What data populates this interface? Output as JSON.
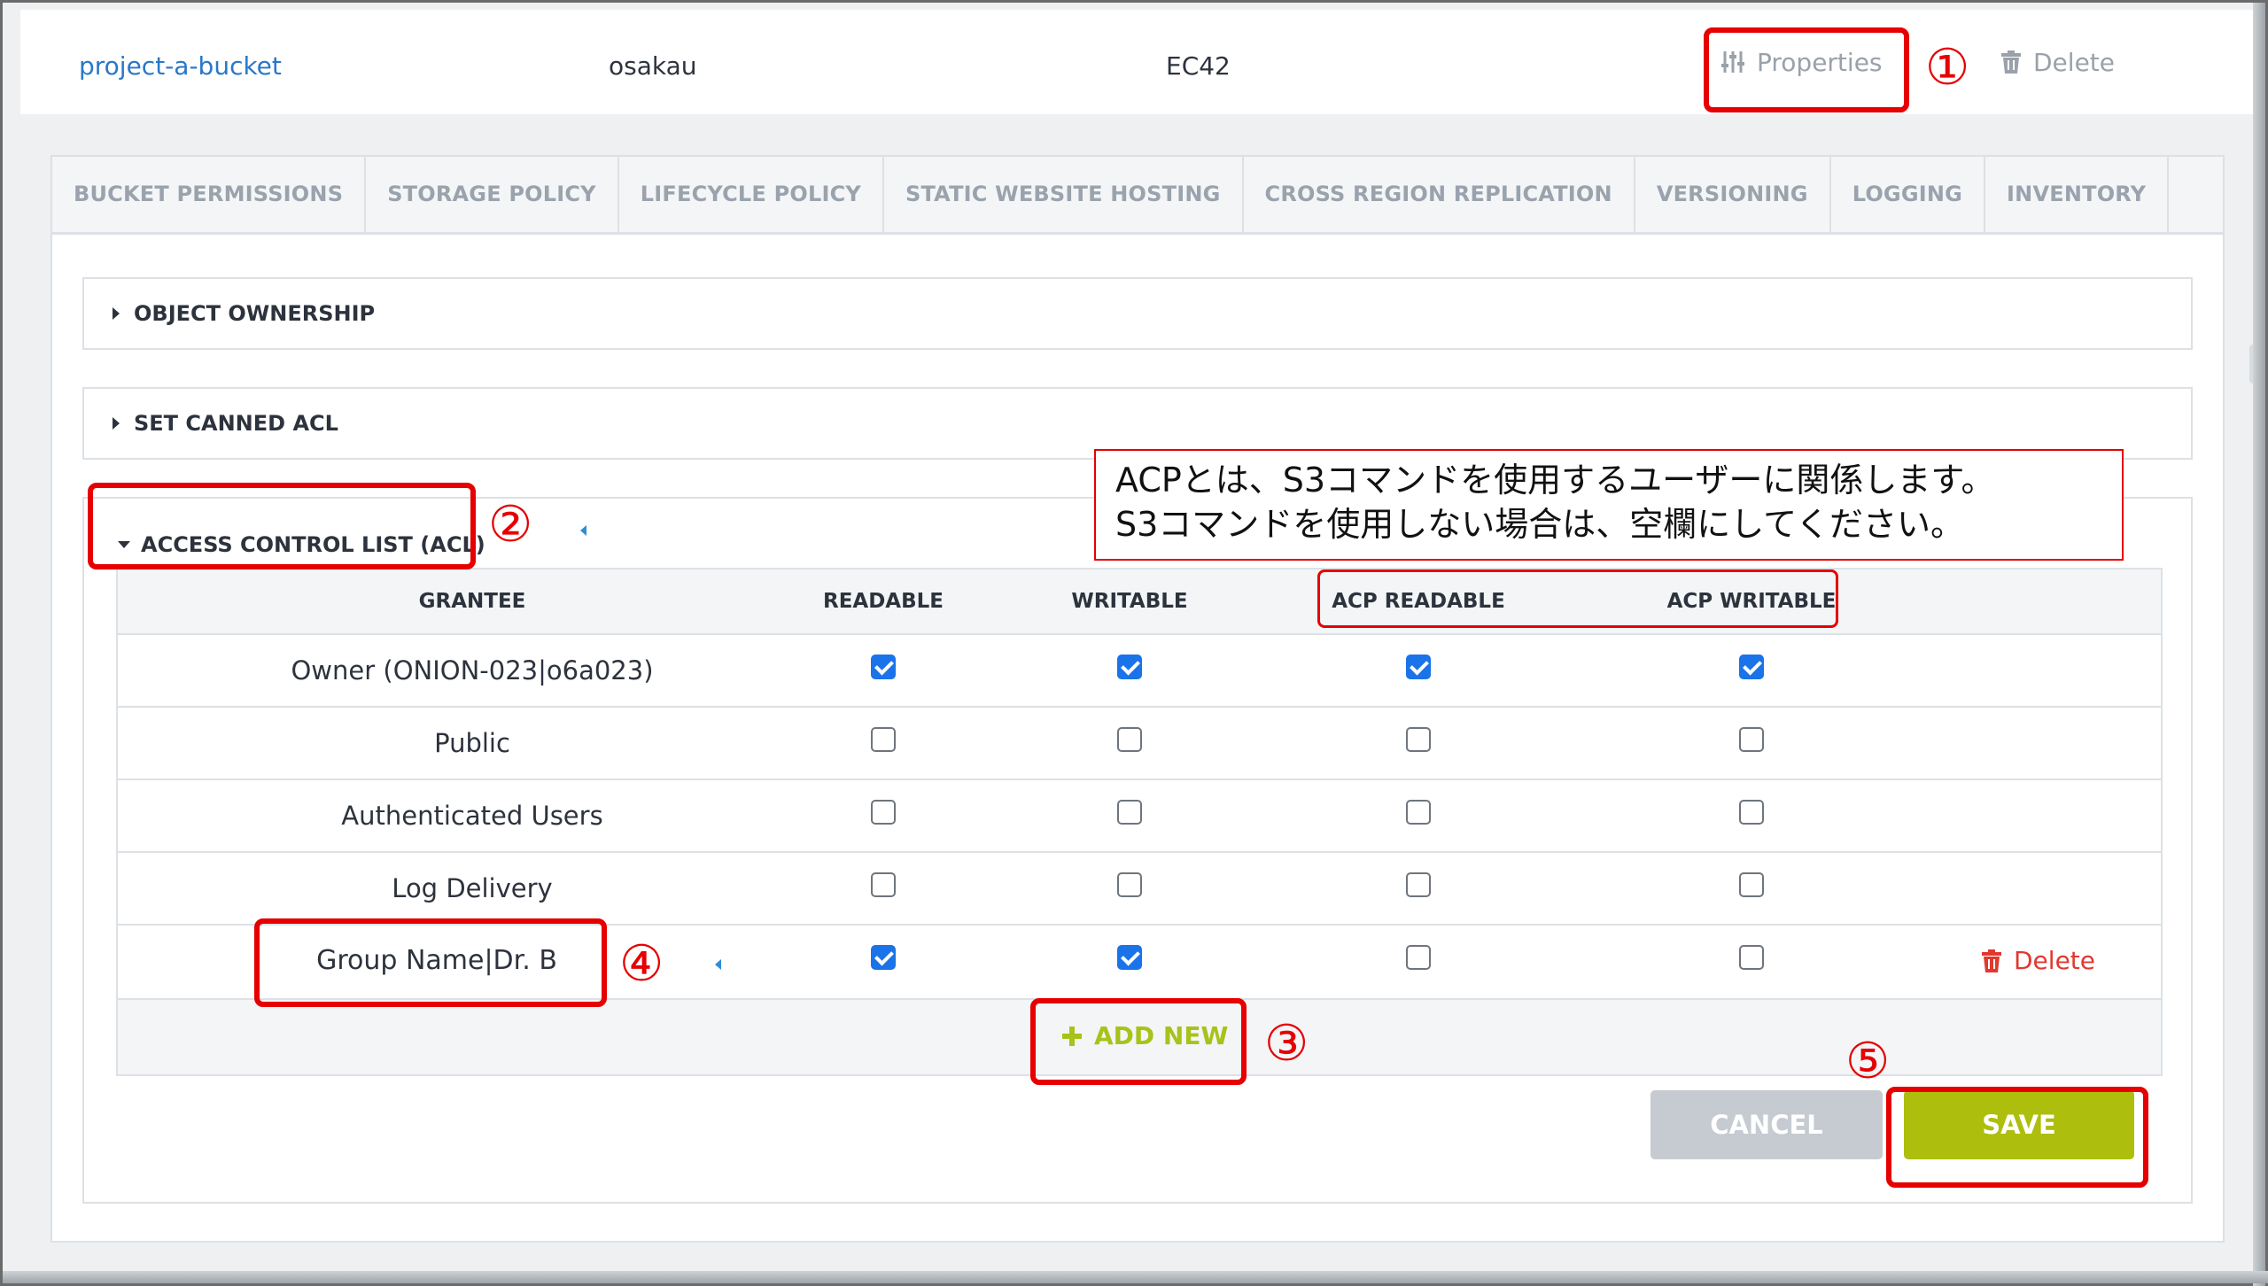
{
  "header": {
    "bucket_name": "project-a-bucket",
    "region": "osakau",
    "storage_policy": "EC42",
    "properties_label": "Properties",
    "delete_label": "Delete"
  },
  "tabs": [
    {
      "label": "BUCKET PERMISSIONS"
    },
    {
      "label": "STORAGE POLICY"
    },
    {
      "label": "LIFECYCLE POLICY"
    },
    {
      "label": "STATIC WEBSITE HOSTING"
    },
    {
      "label": "CROSS REGION REPLICATION"
    },
    {
      "label": "VERSIONING"
    },
    {
      "label": "LOGGING"
    },
    {
      "label": "INVENTORY"
    }
  ],
  "sections": {
    "object_ownership": "OBJECT OWNERSHIP",
    "canned_acl": "SET CANNED ACL",
    "acl": "ACCESS CONTROL LIST (ACL)"
  },
  "table": {
    "headers": {
      "grantee": "GRANTEE",
      "readable": "READABLE",
      "writable": "WRITABLE",
      "acp_readable": "ACP READABLE",
      "acp_writable": "ACP WRITABLE"
    },
    "rows": [
      {
        "grantee": "Owner (ONION-023|o6a023)",
        "readable": true,
        "writable": true,
        "acp_readable": true,
        "acp_writable": true
      },
      {
        "grantee": "Public",
        "readable": false,
        "writable": false,
        "acp_readable": false,
        "acp_writable": false
      },
      {
        "grantee": "Authenticated Users",
        "readable": false,
        "writable": false,
        "acp_readable": false,
        "acp_writable": false
      },
      {
        "grantee": "Log Delivery",
        "readable": false,
        "writable": false,
        "acp_readable": false,
        "acp_writable": false
      },
      {
        "grantee": "Group Name|Dr. B",
        "readable": true,
        "writable": true,
        "acp_readable": false,
        "acp_writable": false,
        "delete_label": "Delete"
      }
    ],
    "add_new_label": "ADD NEW"
  },
  "buttons": {
    "cancel": "CANCEL",
    "save": "SAVE"
  },
  "annotations": {
    "note_line1": "ACPとは、S3コマンドを使用するユーザーに関係します。",
    "note_line2": "S3コマンドを使用しない場合は、空欄にしてください。",
    "markers": [
      "①",
      "②",
      "③",
      "④",
      "⑤"
    ]
  },
  "colors": {
    "link_blue": "#2a78c7",
    "checkbox_blue": "#1a73e8",
    "add_new_green": "#a8c21a",
    "save_green": "#adbe0c",
    "cancel_gray": "#c5cbd1",
    "delete_red": "#e2382f",
    "annotation_red": "#e60000"
  },
  "icons": {
    "properties": "sliders-icon",
    "delete": "trash-icon",
    "add": "plus-icon",
    "expand": "caret-icon"
  }
}
